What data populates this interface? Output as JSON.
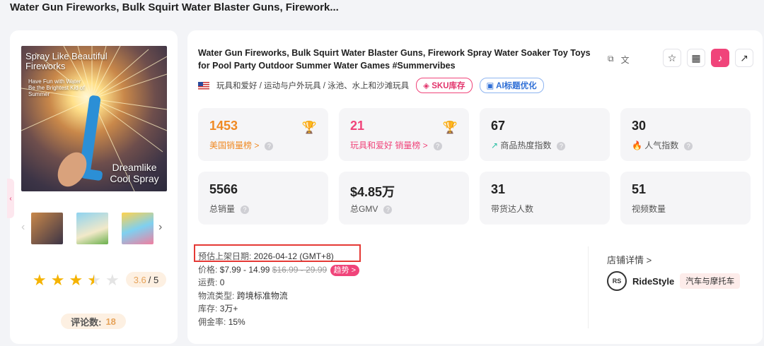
{
  "page_title": "Water Gun Fireworks, Bulk Squirt Water Blaster Guns, Firework...",
  "product": {
    "title": "Water Gun Fireworks, Bulk Squirt Water Blaster Guns, Firework Spray Water Soaker Toy Toys for Pool Party Outdoor Summer Water Games #Summervibes",
    "category_path": "玩具和爱好 / 运动与户外玩具 / 泳池、水上和沙滩玩具",
    "sku_tag": "SKU库存",
    "ai_tag": "AI标题优化",
    "image_texts": {
      "headline": "Spray Like Beautiful Fireworks",
      "sub": "Have Fun with Water Be the Brightest Kid of Summer",
      "bottom": "Dreamlike Cool Spray"
    }
  },
  "left": {
    "rating_score": "3.6",
    "rating_total": "/ 5",
    "stars_value": 3.5,
    "review_label": "评论数:",
    "review_count": "18"
  },
  "stats": [
    {
      "value": "1453",
      "label": "美国销量榜 >",
      "color": "#f08a24"
    },
    {
      "value": "21",
      "label": "玩具和爱好 销量榜 >",
      "color": "#f0447a"
    },
    {
      "value": "67",
      "label": "商品热度指数"
    },
    {
      "value": "30",
      "label": "人气指数"
    },
    {
      "value": "5566",
      "label": "总销量"
    },
    {
      "value": "$4.85万",
      "label": "总GMV"
    },
    {
      "value": "31",
      "label": "带货达人数"
    },
    {
      "value": "51",
      "label": "视频数量"
    }
  ],
  "info": {
    "date_label": "预估上架日期:",
    "date_value": "2026-04-12 (GMT+8)",
    "price_label": "价格:",
    "price_value": "$7.99 - 14.99",
    "price_old": "$16.99 - 29.99",
    "trend_label": "趋势 >",
    "shipping_label": "运费:",
    "shipping_value": "0",
    "logistics_label": "物流类型:",
    "logistics_value": "跨境标准物流",
    "stock_label": "库存:",
    "stock_value": "3万+",
    "commission_label": "佣金率:",
    "commission_value": "15%"
  },
  "store": {
    "link_label": "店铺详情 >",
    "name": "RideStyle",
    "category": "汽车与摩托车",
    "logo_text": "RS"
  }
}
